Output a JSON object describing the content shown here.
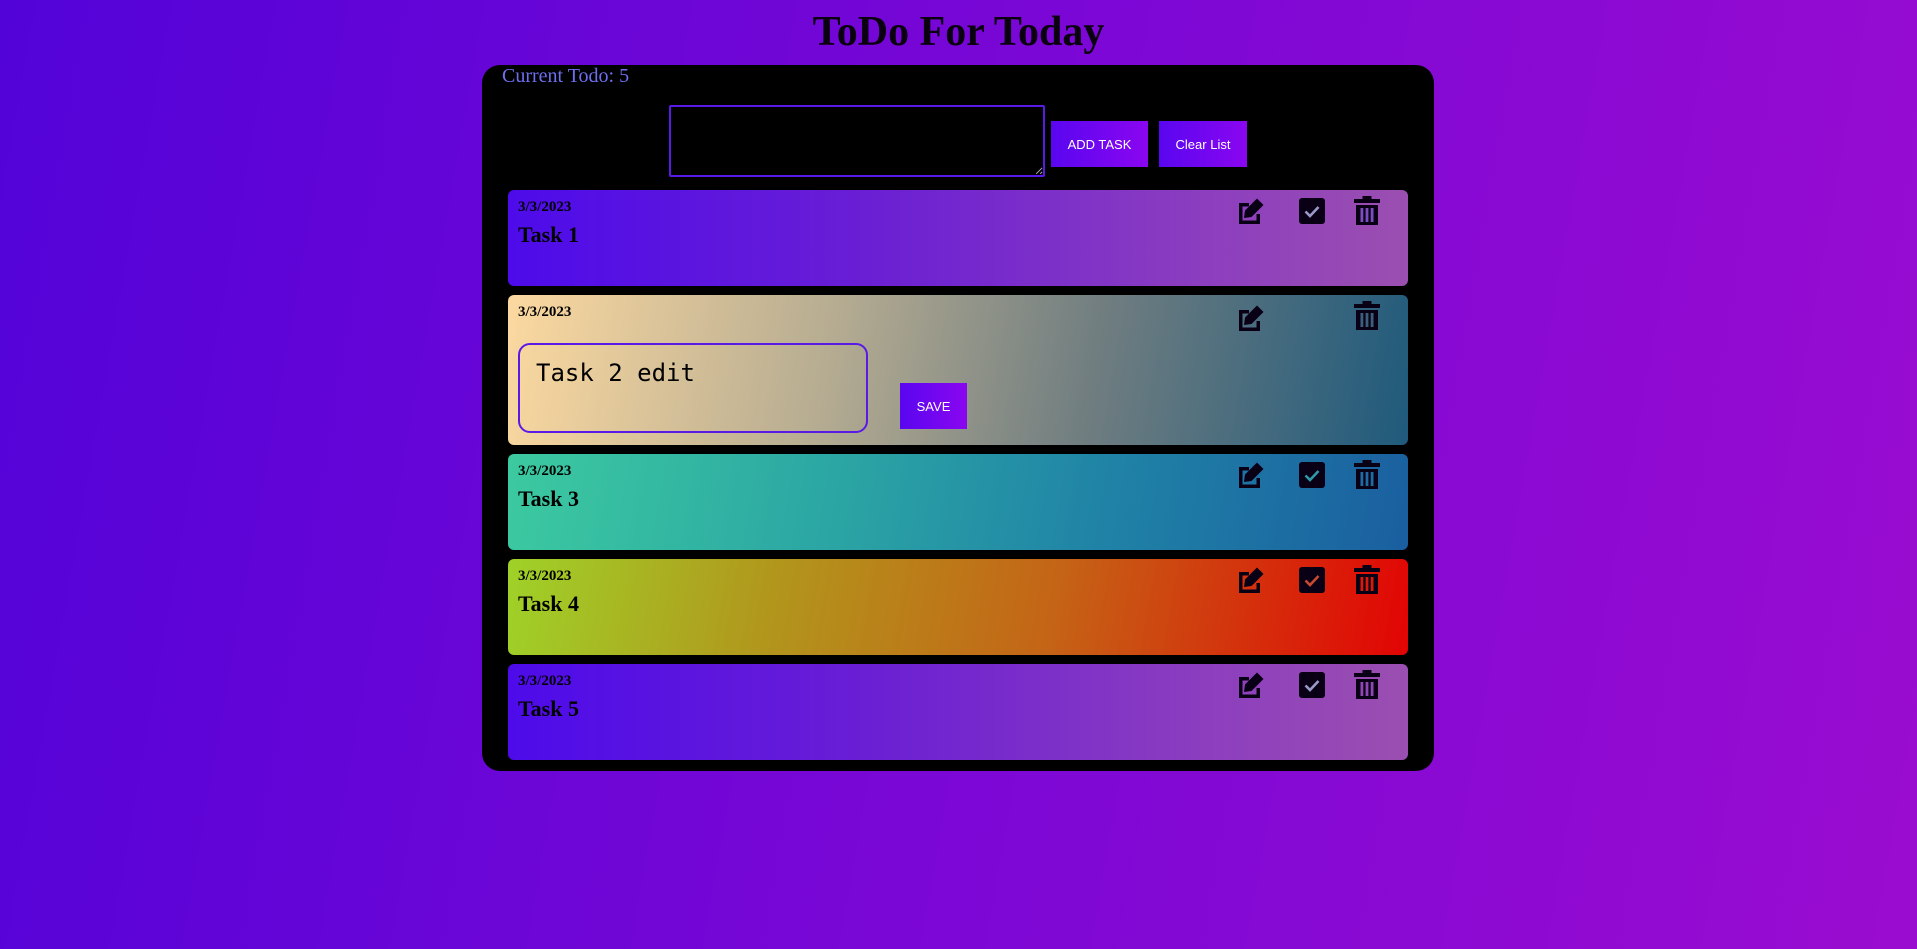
{
  "app": {
    "title": "ToDo For Today"
  },
  "panel": {
    "counter_text": "Current Todo: 5",
    "new_task_placeholder": "",
    "add_button_label": "ADD TASK",
    "clear_button_label": "Clear List"
  },
  "tasks": [
    {
      "date": "3/3/2023",
      "name": "Task 1",
      "editing": false,
      "completed": false
    },
    {
      "date": "3/3/2023",
      "name": "Task 2",
      "editing": true,
      "edit_value": "Task 2 edit",
      "save_label": "SAVE"
    },
    {
      "date": "3/3/2023",
      "name": "Task 3",
      "editing": false,
      "completed": false
    },
    {
      "date": "3/3/2023",
      "name": "Task 4",
      "editing": false,
      "completed": false
    },
    {
      "date": "3/3/2023",
      "name": "Task 5",
      "editing": false,
      "completed": false
    }
  ],
  "icons": {
    "edit": "edit-icon",
    "check": "check-square-icon",
    "delete": "trash-icon"
  },
  "colors": {
    "page_background": [
      "#5203d8",
      "#9a0cd0"
    ],
    "panel_background": "#000000",
    "button_gradient": [
      "#5a06f0",
      "#8a06f0"
    ],
    "counter_text": "#6e6ff0",
    "card_gradients": {
      "purple": [
        "#4d0bea",
        "#9b4fb0"
      ],
      "sand": [
        "#fcd9a0",
        "#1f5a7c"
      ],
      "teal": [
        "#3ccaa0",
        "#1a5fa0"
      ],
      "fire": [
        "#9fd228",
        "#e20404"
      ]
    }
  }
}
